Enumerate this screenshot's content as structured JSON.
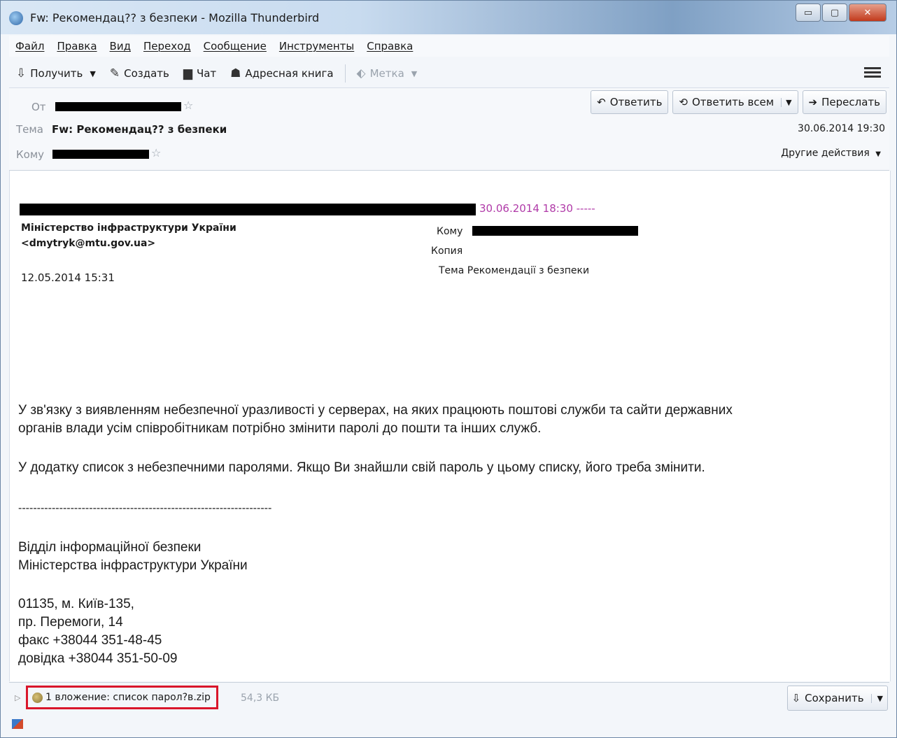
{
  "window": {
    "title": "Fw: Рекомендац?? з безпеки - Mozilla Thunderbird",
    "controls": {
      "minimize": "▭",
      "maximize": "▢",
      "close": "✕"
    }
  },
  "menu": [
    "Файл",
    "Правка",
    "Вид",
    "Переход",
    "Сообщение",
    "Инструменты",
    "Справка"
  ],
  "toolbar": {
    "get": "Получить",
    "write": "Создать",
    "chat": "Чат",
    "address_book": "Адресная книга",
    "tag": "Метка"
  },
  "header": {
    "from_label": "От",
    "subject_label": "Тема",
    "subject": "Fw: Рекомендац?? з безпеки",
    "to_label": "Кому",
    "date": "30.06.2014 19:30",
    "other_actions": "Другие действия",
    "reply": "Ответить",
    "reply_all": "Ответить всем",
    "forward": "Переслать"
  },
  "body": {
    "forward_date": "30.06.2014 18:30 -----",
    "orig_from_name": "Міністерство інфраструктури України",
    "orig_from_email": "<dmytryk@mtu.gov.ua>",
    "orig_date": "12.05.2014 15:31",
    "orig_to_label": "Кому",
    "orig_cc_label": "Копия",
    "orig_subject": "Тема  Рекомендації з безпеки",
    "para1_line1": "У зв'язку з виявленням небезпечної уразливості у серверах, на яких працюють поштові служби та сайти державних",
    "para1_line2": "органів влади усім співробітникам потрібно змінити паролі до пошти та інших служб.",
    "para2": "У додатку список з небезпечними паролями. Якщо Ви знайшли свій пароль у цьому списку, його треба змінити.",
    "divider": "--------------------------------------------------------------------",
    "sig_line1": "Відділ інформаційної безпеки",
    "sig_line2": "Міністерства інфраструктури України",
    "addr_line1": "01135, м. Київ-135,",
    "addr_line2": "пр. Перемоги, 14",
    "fax": "факс +38044 351-48-45",
    "info": "довідка +38044 351-50-09"
  },
  "attachment": {
    "label": "1 вложение: список парол?в.zip",
    "size": "54,3 КБ",
    "save": "Сохранить"
  }
}
